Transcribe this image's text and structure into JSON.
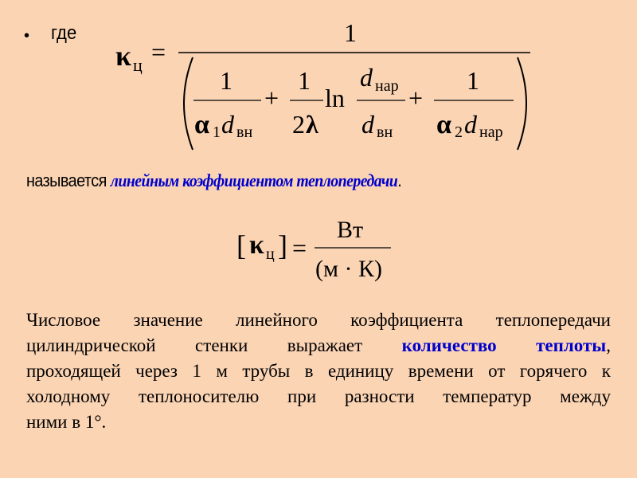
{
  "slide": {
    "background": "#FBD4B4",
    "accent_color": "#0000CC",
    "bullet_glyph": "•",
    "bullet_text": "где",
    "main_formula": {
      "lhs_symbol": "κ",
      "lhs_subscript": "ц",
      "equals": "=",
      "numerator": "1",
      "term1": {
        "numerator": "1",
        "alpha": "α",
        "alpha_index": "1",
        "d": "d",
        "d_sub": "вн"
      },
      "plus1": "+",
      "term2": {
        "numerator": "1",
        "coef": "2",
        "lambda": "λ",
        "ln": "ln",
        "ratio_num_d": "d",
        "ratio_num_sub": "нар",
        "ratio_den_d": "d",
        "ratio_den_sub": "вн"
      },
      "plus2": "+",
      "term3": {
        "numerator": "1",
        "alpha": "α",
        "alpha_index": "2",
        "d": "d",
        "d_sub": "нар"
      }
    },
    "named_line": {
      "prefix": "называется ",
      "term": "линейным коэффициентом теплопередачи",
      "suffix": "."
    },
    "units_formula": {
      "bracket_open": "[",
      "symbol": "κ",
      "subscript": "ц",
      "bracket_close": "]",
      "equals": "=",
      "numerator": "Вт",
      "denominator": "(м · К)"
    },
    "paragraph": {
      "line1": "Числовое значение линейного коэффициента теплопередачи",
      "line2_prefix": "цилиндрической стенки выражает ",
      "line2_term": "количество теплоты",
      "line2_suffix": ",",
      "line3": "проходящей через 1 м трубы в единицу времени от горячего к",
      "line4": "холодному теплоносителю при разности температур между",
      "line5": "ними в 1°."
    }
  }
}
